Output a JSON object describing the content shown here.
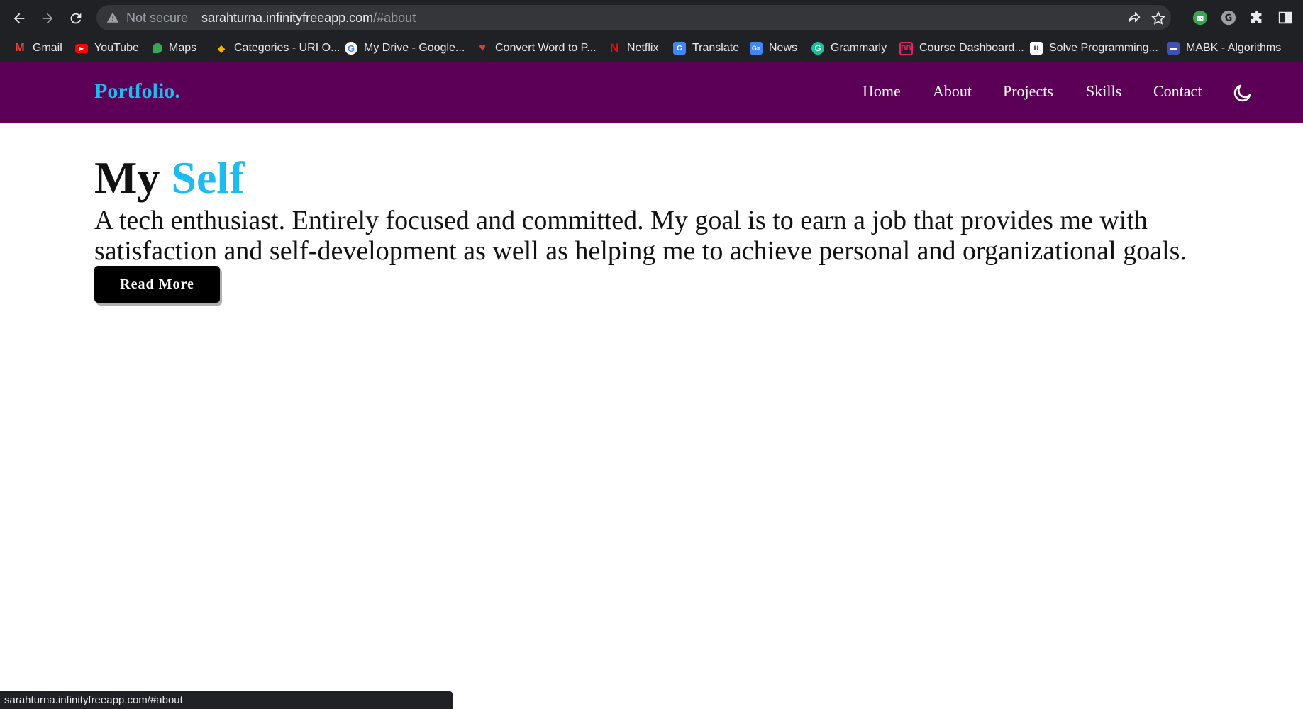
{
  "browser": {
    "security_label": "Not secure",
    "url_host": "sarahturna.infinityfreeapp.com",
    "url_path": "/#about"
  },
  "bookmarks": [
    {
      "label": "Gmail",
      "icon": "gmail-icon",
      "color": "#ea4335"
    },
    {
      "label": "YouTube",
      "icon": "youtube-icon",
      "color": "#ff0000"
    },
    {
      "label": "Maps",
      "icon": "maps-icon",
      "color": "#34a853"
    },
    {
      "label": "Categories - URI O...",
      "icon": "uri-icon",
      "color": "#f4b400"
    },
    {
      "label": "My Drive - Google...",
      "icon": "google-icon",
      "color": "#4285f4"
    },
    {
      "label": "Convert Word to P...",
      "icon": "heart-icon",
      "color": "#e53935"
    },
    {
      "label": "Netflix",
      "icon": "netflix-icon",
      "color": "#e50914"
    },
    {
      "label": "Translate",
      "icon": "translate-icon",
      "color": "#4285f4"
    },
    {
      "label": "News",
      "icon": "news-icon",
      "color": "#4285f4"
    },
    {
      "label": "Grammarly",
      "icon": "grammarly-icon",
      "color": "#15c39a"
    },
    {
      "label": "Course Dashboard...",
      "icon": "course-icon",
      "color": "#e91e63"
    },
    {
      "label": "Solve Programming...",
      "icon": "hackerrank-icon",
      "color": "#000000"
    },
    {
      "label": "MABK - Algorithms",
      "icon": "mabk-icon",
      "color": "#3f51b5"
    }
  ],
  "site": {
    "logo": "Portfolio.",
    "menu": [
      "Home",
      "About",
      "Projects",
      "Skills",
      "Contact"
    ],
    "brand_color": "#5c0057",
    "accent_color": "#1ebbee"
  },
  "about": {
    "heading_plain": "My",
    "heading_accent": "Self",
    "bio": "A tech enthusiast. Entirely focused and committed. My goal is to earn a job that provides me with satisfaction and self-development as well as helping me to achieve personal and organizational goals.",
    "button_label": "Read More"
  },
  "status_bar": "sarahturna.infinityfreeapp.com/#about"
}
